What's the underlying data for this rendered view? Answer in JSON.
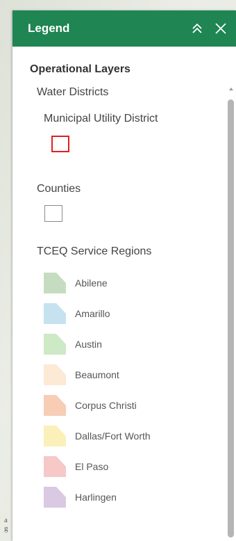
{
  "map_edge": {
    "line1": "a",
    "line2": "g"
  },
  "legend": {
    "title": "Legend",
    "section_title": "Operational Layers",
    "water_districts": {
      "title": "Water Districts",
      "subtitle": "Municipal Utility District",
      "swatch_color": "#e11f1f"
    },
    "counties": {
      "title": "Counties",
      "swatch_color": "#8a8a8a"
    },
    "regions": {
      "title": "TCEQ Service Regions",
      "items": [
        {
          "label": "Abilene",
          "color": "#c6dcc0"
        },
        {
          "label": "Amarillo",
          "color": "#c6e2f1"
        },
        {
          "label": "Austin",
          "color": "#cde9c5"
        },
        {
          "label": "Beaumont",
          "color": "#fce9d6"
        },
        {
          "label": "Corpus Christi",
          "color": "#f7cdb6"
        },
        {
          "label": "Dallas/Fort Worth",
          "color": "#fbf0b9"
        },
        {
          "label": "El Paso",
          "color": "#f6c8c8"
        },
        {
          "label": "Harlingen",
          "color": "#dac9e3"
        }
      ]
    }
  },
  "icons": {
    "collapse": "double-chevron-up-icon",
    "close": "close-icon"
  },
  "theme": {
    "header_bg": "#1e8553",
    "header_text": "#ffffff"
  }
}
